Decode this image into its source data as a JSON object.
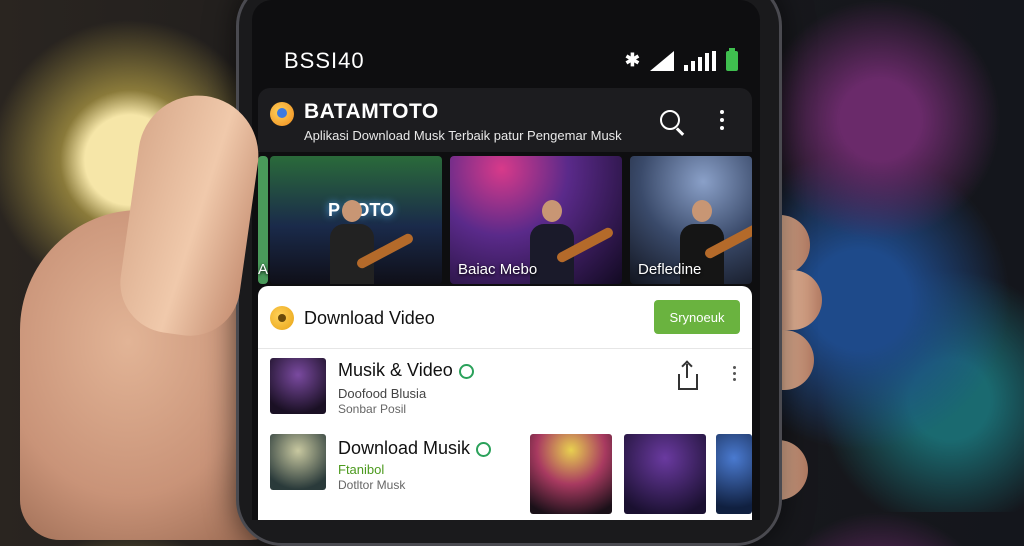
{
  "status_bar": {
    "time": "BSSI40"
  },
  "app": {
    "title": "BATAMTOTO",
    "subtitle": "Aplikasi Download Musk Terbaik patur Pengemar Musk"
  },
  "carousel": {
    "sign_text": "P  TOTO",
    "items": [
      {
        "label": "Ai"
      },
      {
        "label": ""
      },
      {
        "label": "Baiac Mebo"
      },
      {
        "label": "Defledine"
      }
    ]
  },
  "download_bar": {
    "title": "Download Video",
    "button": "Srynoeuk"
  },
  "list": [
    {
      "title": "Musik & Video",
      "line1": "Doofood Blusia",
      "line2": "Sonbar Posil"
    },
    {
      "title": "Download Musik",
      "line1": "Ftanibol",
      "line2": "Dotltor Musk"
    }
  ],
  "colors": {
    "accent": "#6ab33f",
    "header_bg": "#1c1c1f",
    "battery": "#3fbf4f"
  }
}
